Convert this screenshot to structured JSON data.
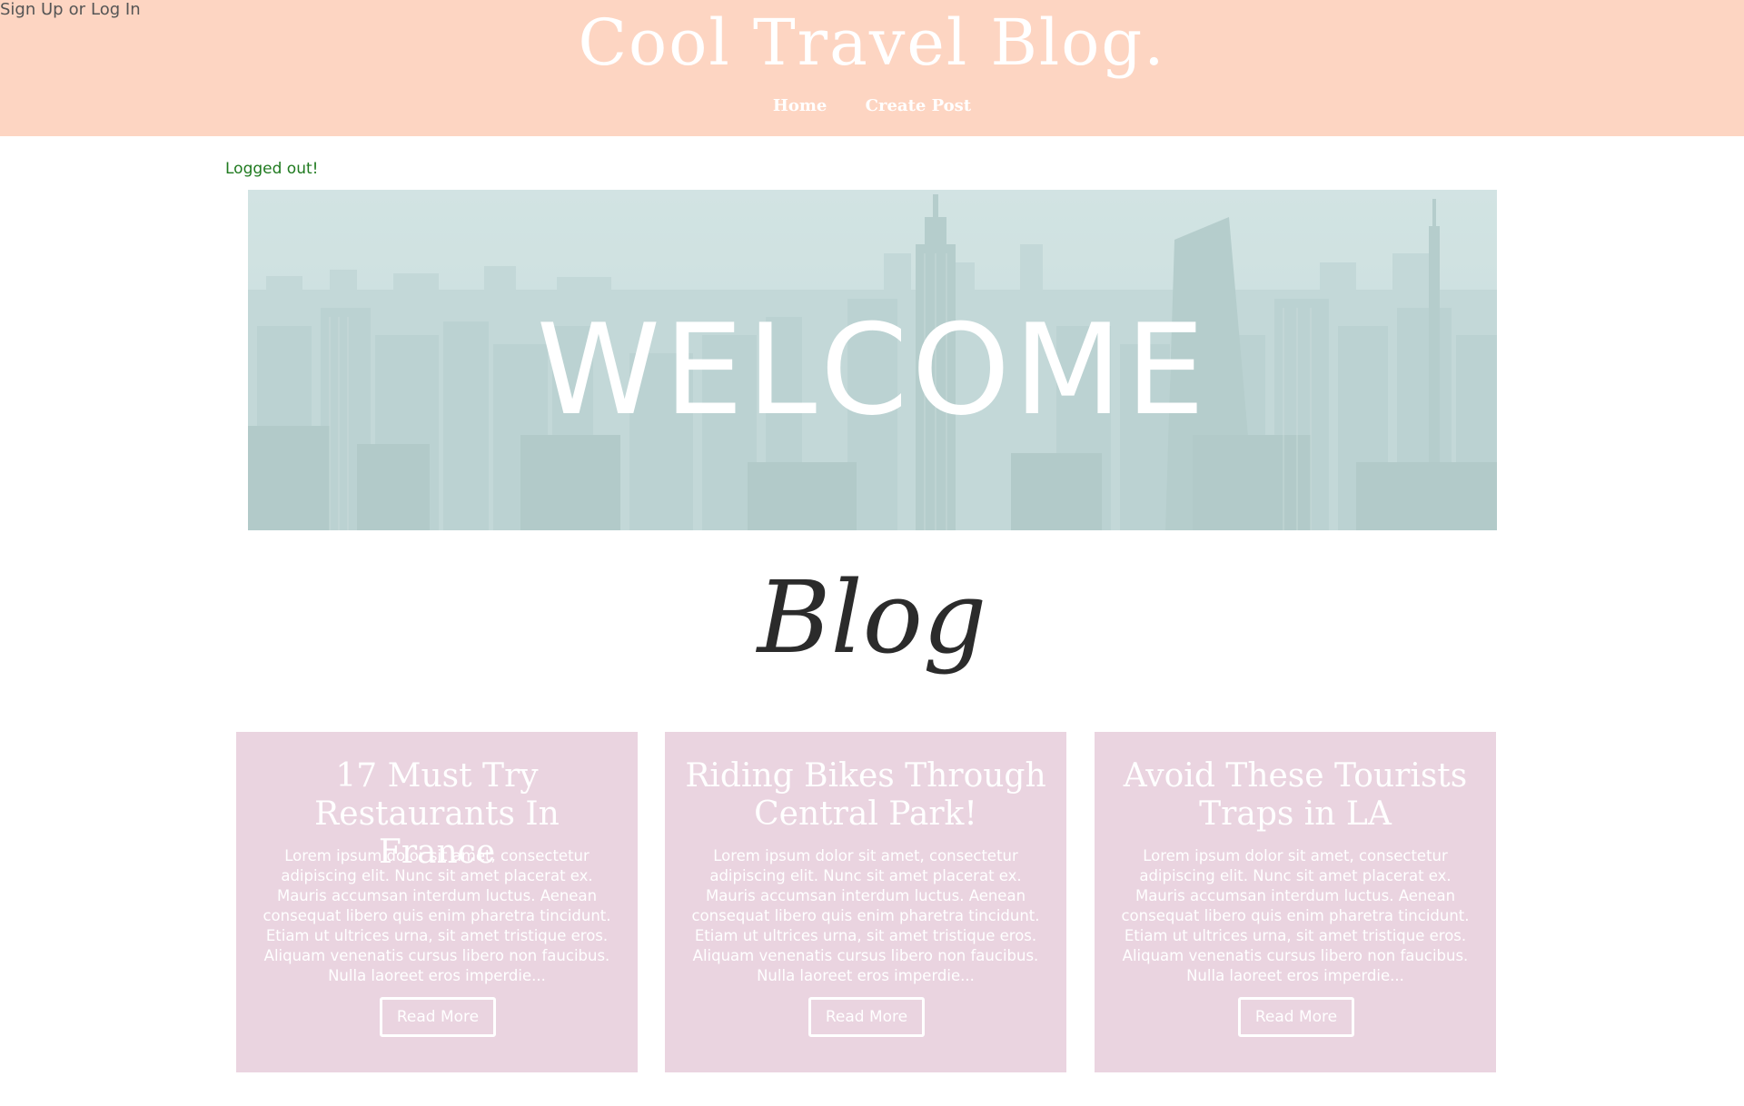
{
  "auth": {
    "signup": "Sign Up",
    "or": "or",
    "login": "Log In"
  },
  "site": {
    "title": "Cool Travel Blog."
  },
  "nav": {
    "home": "Home",
    "create_post": "Create Post"
  },
  "flash": {
    "message": "Logged out!"
  },
  "hero": {
    "title": "WELCOME"
  },
  "blog": {
    "heading": "Blog"
  },
  "cards": [
    {
      "title": "17 Must Try Restaurants In France",
      "excerpt": "Lorem ipsum dolor sit amet, consectetur adipiscing elit. Nunc sit amet placerat ex. Mauris accumsan interdum luctus. Aenean consequat libero quis enim pharetra tincidunt. Etiam ut ultrices urna, sit amet tristique eros. Aliquam venenatis cursus libero non faucibus. Nulla laoreet eros imperdie...",
      "button": "Read More"
    },
    {
      "title": "Riding Bikes Through Central Park!",
      "excerpt": "Lorem ipsum dolor sit amet, consectetur adipiscing elit. Nunc sit amet placerat ex. Mauris accumsan interdum luctus. Aenean consequat libero quis enim pharetra tincidunt. Etiam ut ultrices urna, sit amet tristique eros. Aliquam venenatis cursus libero non faucibus. Nulla laoreet eros imperdie...",
      "button": "Read More"
    },
    {
      "title": "Avoid These Tourists Traps in LA",
      "excerpt": "Lorem ipsum dolor sit amet, consectetur adipiscing elit. Nunc sit amet placerat ex. Mauris accumsan interdum luctus. Aenean consequat libero quis enim pharetra tincidunt. Etiam ut ultrices urna, sit amet tristique eros. Aliquam venenatis cursus libero non faucibus. Nulla laoreet eros imperdie...",
      "button": "Read More"
    }
  ],
  "colors": {
    "header_bg": "#fdd5c2",
    "card_bg": "#ead4e0",
    "hero_tint": "#c6dcdc",
    "flash_text": "#1f7a1f"
  }
}
